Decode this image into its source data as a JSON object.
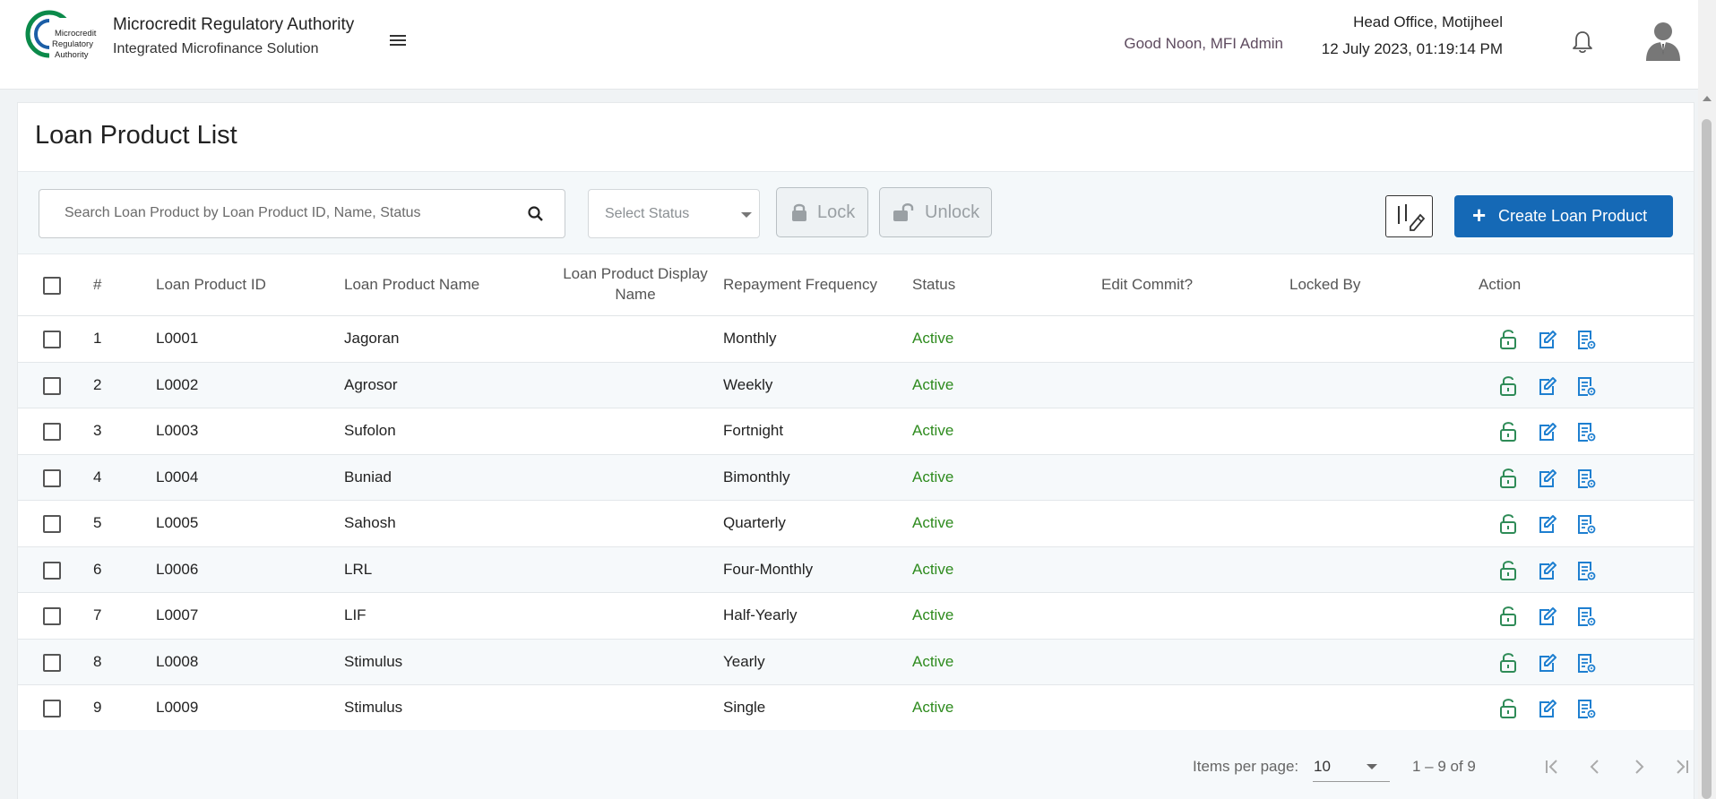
{
  "header": {
    "logo_text": [
      "Microcredit",
      "Regulatory",
      "Authority"
    ],
    "app_title": "Microcredit Regulatory Authority",
    "app_subtitle": "Integrated Microfinance Solution",
    "greeting": "Good Noon, MFI Admin",
    "office": "Head Office, Motijheel",
    "datetime": "12 July 2023, 01:19:14 PM"
  },
  "page": {
    "title": "Loan Product List"
  },
  "toolbar": {
    "search_placeholder": "Search Loan Product by Loan Product ID, Name, Status",
    "status_placeholder": "Select Status",
    "lock_label": "Lock",
    "unlock_label": "Unlock",
    "create_label": "Create Loan Product"
  },
  "table": {
    "headers": {
      "num": "#",
      "id": "Loan Product ID",
      "name": "Loan Product Name",
      "display_name": "Loan Product Display Name",
      "frequency": "Repayment Frequency",
      "status": "Status",
      "edit_commit": "Edit Commit?",
      "locked_by": "Locked By",
      "action": "Action"
    },
    "rows": [
      {
        "num": "1",
        "id": "L0001",
        "name": "Jagoran",
        "display_name": "",
        "frequency": "Monthly",
        "status": "Active",
        "edit_commit": "",
        "locked_by": ""
      },
      {
        "num": "2",
        "id": "L0002",
        "name": "Agrosor",
        "display_name": "",
        "frequency": "Weekly",
        "status": "Active",
        "edit_commit": "",
        "locked_by": ""
      },
      {
        "num": "3",
        "id": "L0003",
        "name": "Sufolon",
        "display_name": "",
        "frequency": "Fortnight",
        "status": "Active",
        "edit_commit": "",
        "locked_by": ""
      },
      {
        "num": "4",
        "id": "L0004",
        "name": "Buniad",
        "display_name": "",
        "frequency": "Bimonthly",
        "status": "Active",
        "edit_commit": "",
        "locked_by": ""
      },
      {
        "num": "5",
        "id": "L0005",
        "name": "Sahosh",
        "display_name": "",
        "frequency": "Quarterly",
        "status": "Active",
        "edit_commit": "",
        "locked_by": ""
      },
      {
        "num": "6",
        "id": "L0006",
        "name": "LRL",
        "display_name": "",
        "frequency": "Four-Monthly",
        "status": "Active",
        "edit_commit": "",
        "locked_by": ""
      },
      {
        "num": "7",
        "id": "L0007",
        "name": "LIF",
        "display_name": "",
        "frequency": "Half-Yearly",
        "status": "Active",
        "edit_commit": "",
        "locked_by": ""
      },
      {
        "num": "8",
        "id": "L0008",
        "name": "Stimulus",
        "display_name": "",
        "frequency": "Yearly",
        "status": "Active",
        "edit_commit": "",
        "locked_by": ""
      },
      {
        "num": "9",
        "id": "L0009",
        "name": "Stimulus",
        "display_name": "",
        "frequency": "Single",
        "status": "Active",
        "edit_commit": "",
        "locked_by": ""
      }
    ],
    "row_icons": [
      "unlock-icon",
      "edit-icon",
      "view-details-icon"
    ]
  },
  "pagination": {
    "items_per_page_label": "Items per page:",
    "items_per_page": "10",
    "range": "1 – 9 of 9"
  },
  "colors": {
    "primary": "#1569b6",
    "active_status": "#2e8b1e",
    "unlock_icon": "#2e8b57",
    "action_icon": "#1e7fd0"
  }
}
